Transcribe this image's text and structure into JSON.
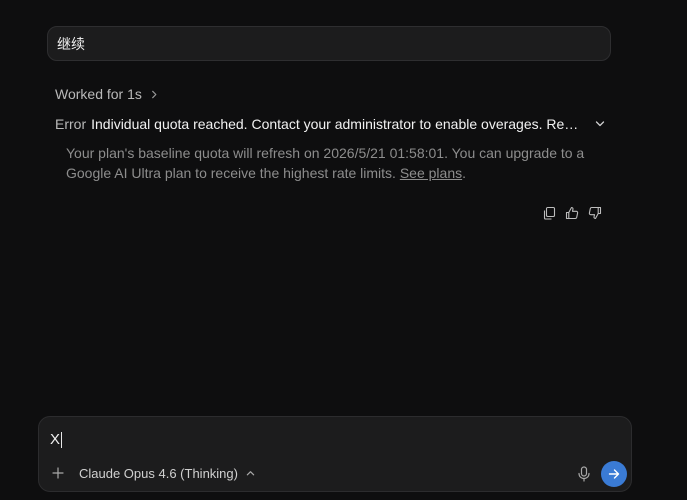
{
  "user_message": {
    "text": "继续"
  },
  "worked": {
    "label": "Worked for 1s"
  },
  "error": {
    "prefix": "Error",
    "message": "Individual quota reached. Contact your administrator to enable overages. Resets in"
  },
  "detail": {
    "text": "Your plan's baseline quota will refresh on 2026/5/21 01:58:01. You can upgrade to a Google AI Ultra plan to receive the highest rate limits. ",
    "link": "See plans",
    "suffix": "."
  },
  "message_actions": {
    "icons": [
      "copy-icon",
      "thumbs-up-icon",
      "thumbs-down-icon"
    ]
  },
  "composer": {
    "input_value": "X",
    "model_label": "Claude Opus 4.6 (Thinking)",
    "accent_color": "#3a7bd5"
  }
}
